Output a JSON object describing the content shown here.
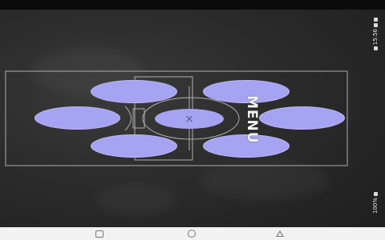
{
  "screen": {
    "title": "MENU",
    "center_symbol": "×",
    "menu_buttons": [
      {
        "id": "top-left"
      },
      {
        "id": "top-right"
      },
      {
        "id": "mid-left"
      },
      {
        "id": "mid-right"
      },
      {
        "id": "bottom-left"
      },
      {
        "id": "bottom-right"
      }
    ]
  },
  "status": {
    "top_text": "15:56",
    "bottom_text": "100%"
  },
  "colors": {
    "button_fill": "#a6a3f2",
    "chalkboard": "#2b2b2b",
    "chalk": "#e0e0e0"
  },
  "icons": {
    "nav_recents": "square-icon",
    "nav_home": "circle-icon",
    "nav_back": "triangle-icon"
  }
}
